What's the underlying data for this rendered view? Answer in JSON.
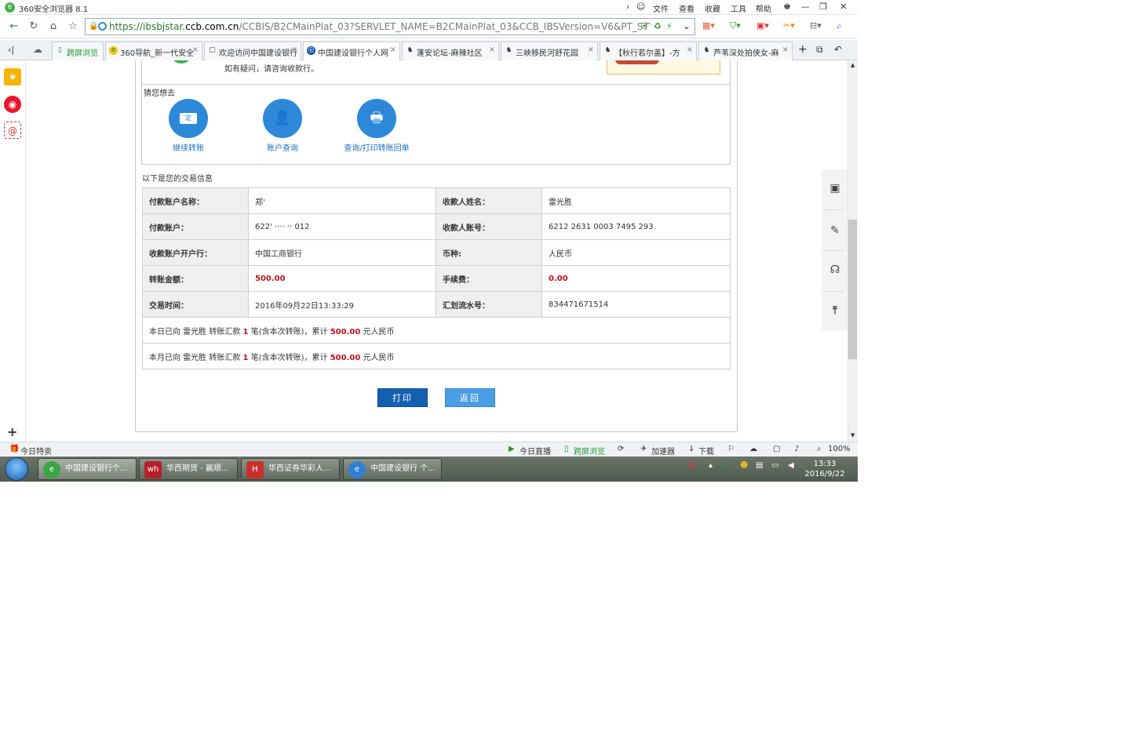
{
  "window": {
    "title": "360安全浏览器 8.1",
    "menu": [
      "文件",
      "查看",
      "收藏",
      "工具",
      "帮助"
    ],
    "controls": [
      "—",
      "❐",
      "✕"
    ]
  },
  "address": {
    "url_prefix": "https://ibsbjstar.",
    "url_domain": "ccb.com.cn",
    "url_rest": "/CCBIS/B2CMainPlat_03?SERVLET_NAME=B2CMainPlat_03&CCB_IBSVersion=V6&PT_STY"
  },
  "tabs": [
    {
      "label": "跨屏浏览",
      "icon": "phone-icon"
    },
    {
      "label": "360导航_新一代安全",
      "icon": "360-icon"
    },
    {
      "label": "欢迎访问中国建设银行",
      "icon": "page-icon"
    },
    {
      "label": "中国建设银行个人网",
      "icon": "ccb-icon",
      "active": true
    },
    {
      "label": "蓬安论坛-麻辣社区",
      "icon": "bbs-icon"
    },
    {
      "label": "三峡移民河舒花园",
      "icon": "bbs-icon"
    },
    {
      "label": "【秋行若尔盖】-方",
      "icon": "bbs-icon"
    },
    {
      "label": "芦苇深处拍侠女-麻",
      "icon": "bbs-icon"
    }
  ],
  "page": {
    "notice": "如有疑问，请咨询收款行。",
    "guess_title": "猜您想去",
    "quick_actions": [
      {
        "label": "继续转账",
        "icon": "transfer-icon"
      },
      {
        "label": "账户查询",
        "icon": "account-search-icon"
      },
      {
        "label": "查询/打印转账回单",
        "icon": "print-receipt-icon"
      }
    ],
    "info_title": "以下是您的交易信息",
    "rows": [
      {
        "k1": "付款账户名称：",
        "v1": "郑'",
        "k2": "收款人姓名：",
        "v2": "雷光胜"
      },
      {
        "k1": "付款账户：",
        "v1": "622' ···· ·· 012",
        "k2": "收款人账号：",
        "v2": "6212 2631 0003 7495 293"
      },
      {
        "k1": "收款账户开户行：",
        "v1": "中国工商银行",
        "k2": "币种:",
        "v2": "人民币"
      },
      {
        "k1": "转账金额：",
        "v1": "500.00",
        "k2": "手续费：",
        "v2": "0.00"
      },
      {
        "k1": "交易时间：",
        "v1": "2016年09月22日13:33:29",
        "k2": "汇划流水号：",
        "v2": "834471671514"
      }
    ],
    "summary": [
      {
        "pre": "本日已向 雷光胜 转账汇款 ",
        "count": "1",
        "mid": " 笔(含本次转账)，累计 ",
        "amount": "500.00",
        "post": " 元人民币"
      },
      {
        "pre": "本月已向 雷光胜 转账汇款 ",
        "count": "1",
        "mid": " 笔(含本次转账)，累计 ",
        "amount": "500.00",
        "post": " 元人民币"
      }
    ],
    "print_label": "打印",
    "back_label": "返回"
  },
  "statusbar": {
    "left": "今日特卖",
    "items": [
      "今日直播",
      "跨屏浏览",
      "加速器",
      "下载"
    ],
    "zoom": "100%"
  },
  "taskbar": {
    "tasks": [
      {
        "label": "中国建设银行个...",
        "icon": "360-browser-icon",
        "color": "#3aa543"
      },
      {
        "label": "华西期货 - 赢顺...",
        "icon": "wh6-icon",
        "color": "#b3202a"
      },
      {
        "label": "华西证券华彩人...",
        "icon": "hx-icon",
        "color": "#c8302e"
      },
      {
        "label": "中国建设银行 个...",
        "icon": "ie-icon",
        "color": "#2f7fd5"
      }
    ],
    "time": "13:33",
    "date": "2016/9/22"
  }
}
